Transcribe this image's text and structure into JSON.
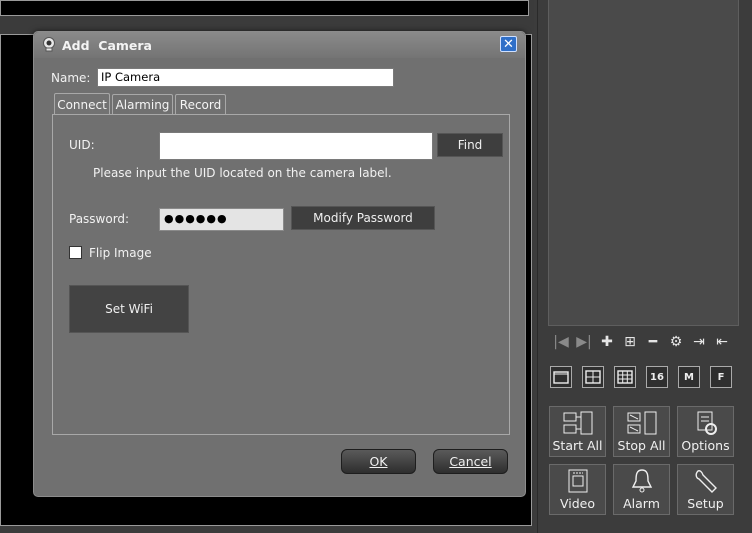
{
  "dialog": {
    "title": "Add  Camera",
    "name_label": "Name:",
    "name_value": "IP Camera",
    "tabs": [
      {
        "label": "Connect",
        "active": true
      },
      {
        "label": "Alarming",
        "active": false
      },
      {
        "label": "Record",
        "active": false
      }
    ],
    "uid_label": "UID:",
    "uid_value": "",
    "find_label": "Find",
    "uid_hint": "Please input the UID located on the camera label.",
    "password_label": "Password:",
    "password_value": "●●●●●●",
    "modify_password_label": "Modify Password",
    "flip_image_label": "Flip Image",
    "flip_image_checked": false,
    "set_wifi_label": "Set WiFi",
    "ok_label": "OK",
    "cancel_label": "Cancel"
  },
  "layouts": [
    "",
    "",
    "",
    "16",
    "M",
    "F"
  ],
  "actions": [
    {
      "label": "Start All",
      "icon": "camera-start-icon"
    },
    {
      "label": "Stop All",
      "icon": "camera-stop-icon"
    },
    {
      "label": "Options",
      "icon": "options-icon"
    },
    {
      "label": "Video",
      "icon": "video-file-icon"
    },
    {
      "label": "Alarm",
      "icon": "bell-icon"
    },
    {
      "label": "Setup",
      "icon": "wrench-icon"
    }
  ],
  "colors": {
    "dialog_bg": "#707070",
    "close_button": "#2f6fc8",
    "panel_bg": "#3c3c3c"
  }
}
